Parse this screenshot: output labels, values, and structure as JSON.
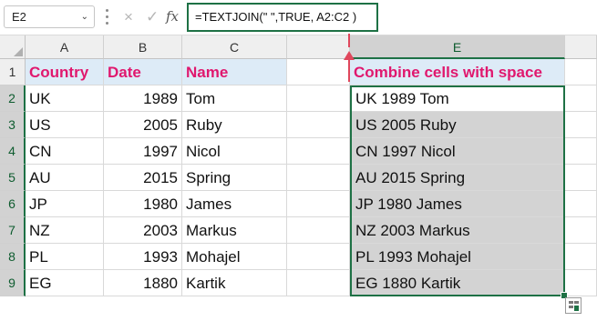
{
  "name_box": {
    "value": "E2"
  },
  "formula_bar": {
    "cancel_icon": "×",
    "enter_icon": "✓",
    "fx": "fx",
    "formula": "=TEXTJOIN(\" \",TRUE, A2:C2 )"
  },
  "columns": [
    "A",
    "B",
    "C",
    "",
    "E"
  ],
  "rows": [
    "1",
    "2",
    "3",
    "4",
    "5",
    "6",
    "7",
    "8",
    "9"
  ],
  "table": {
    "headers": {
      "country": "Country",
      "date": "Date",
      "name": "Name"
    },
    "rows": [
      {
        "country": "UK",
        "date": "1989",
        "name": "Tom"
      },
      {
        "country": "US",
        "date": "2005",
        "name": "Ruby"
      },
      {
        "country": "CN",
        "date": "1997",
        "name": "Nicol"
      },
      {
        "country": "AU",
        "date": "2015",
        "name": "Spring"
      },
      {
        "country": "JP",
        "date": "1980",
        "name": "James"
      },
      {
        "country": "NZ",
        "date": "2003",
        "name": "Markus"
      },
      {
        "country": "PL",
        "date": "1993",
        "name": "Mohajel"
      },
      {
        "country": "EG",
        "date": "1880",
        "name": "Kartik"
      }
    ]
  },
  "result": {
    "header": "Combine cells with space",
    "values": [
      "UK 1989 Tom",
      "US 2005 Ruby",
      "CN 1997 Nicol",
      "AU 2015 Spring",
      "JP 1980 James",
      "NZ 2003 Markus",
      "PL 1993 Mohajel",
      "EG 1880 Kartik"
    ]
  },
  "colors": {
    "header_text": "#e0186e",
    "header_fill": "#ddebf7",
    "selection": "#1e7145",
    "arrow": "#e0475c",
    "result_fill": "#d3d3d3"
  },
  "icons": {
    "quick_analysis": "quick-analysis-icon",
    "dropdown": "chevron-down-icon"
  }
}
